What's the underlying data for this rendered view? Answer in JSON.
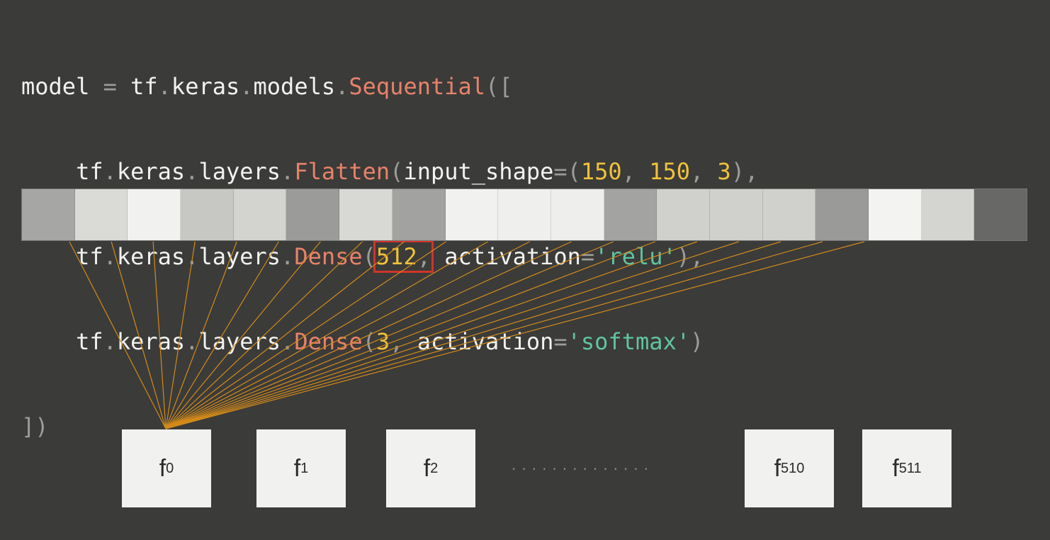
{
  "code": {
    "line1": {
      "a": "model ",
      "b": "=",
      "c": " tf",
      "d": ".",
      "e": "keras",
      "f": ".",
      "g": "models",
      "h": ".",
      "i": "Sequential",
      "j": "(["
    },
    "line2": {
      "indent": "    ",
      "a": "tf",
      "b": ".",
      "c": "keras",
      "d": ".",
      "e": "layers",
      "f": ".",
      "g": "Flatten",
      "h": "(",
      "i": "input_shape",
      "j": "=",
      "k": "(",
      "l": "150",
      "m": ", ",
      "n": "150",
      "o": ", ",
      "p": "3",
      "q": "),"
    },
    "line3": {
      "indent": "    ",
      "a": "tf",
      "b": ".",
      "c": "keras",
      "d": ".",
      "e": "layers",
      "f": ".",
      "g": "Dense",
      "h": "(",
      "i": "512",
      "j": ",",
      "k": " activation",
      "l": "=",
      "m": "'relu'",
      "n": "),"
    },
    "line4": {
      "indent": "    ",
      "a": "tf",
      "b": ".",
      "c": "keras",
      "d": ".",
      "e": "layers",
      "f": ".",
      "g": "Dense",
      "h": "(",
      "i": "3",
      "j": ",",
      "k": " activation",
      "l": "=",
      "m": "'softmax'",
      "n": ")"
    },
    "line5": {
      "a": "])"
    }
  },
  "colors": {
    "background": "#3b3b39",
    "function": "#e8826a",
    "number": "#f0c23a",
    "string": "#5fc4a2",
    "highlight_box": "#d0342c",
    "connection_line": "#d48a1a"
  },
  "strip_cells": [
    "#a6a6a4",
    "#dadad7",
    "#f1f1ef",
    "#c7c7c4",
    "#d3d3d0",
    "#9b9b99",
    "#d8d8d5",
    "#a2a2a0",
    "#f1f1ef",
    "#efefed",
    "#eeeeec",
    "#a3a3a1",
    "#d0d0cd",
    "#d0d0cd",
    "#d0d0cd",
    "#9a9a98",
    "#f3f3f1",
    "#d4d4d1",
    "#686866"
  ],
  "neurons": [
    {
      "base": "f",
      "sub": "0"
    },
    {
      "base": "f",
      "sub": "1"
    },
    {
      "base": "f",
      "sub": "2"
    },
    {
      "base": "f",
      "sub": "510"
    },
    {
      "base": "f",
      "sub": "511"
    }
  ],
  "ellipsis": "··············"
}
